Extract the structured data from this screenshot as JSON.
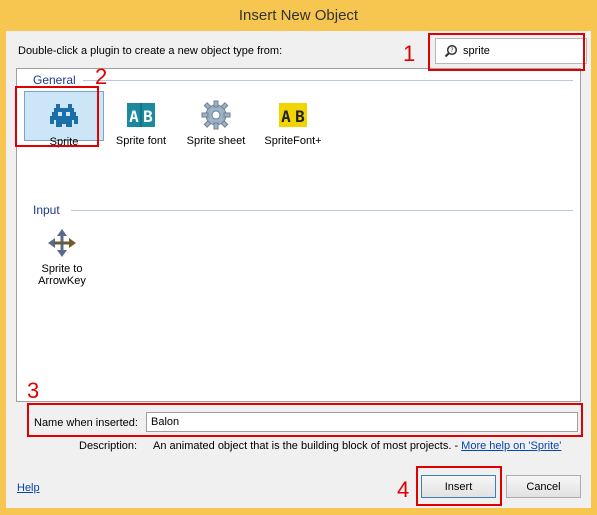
{
  "window": {
    "title": "Insert New Object"
  },
  "instruction": "Double-click a plugin to create a new object type from:",
  "search": {
    "value": "sprite"
  },
  "groups": [
    {
      "label": "General",
      "items": [
        {
          "label": "Sprite",
          "icon": "space-invader-icon",
          "selected": true
        },
        {
          "label": "Sprite font",
          "icon": "ab-font-icon"
        },
        {
          "label": "Sprite sheet",
          "icon": "gear-icon"
        },
        {
          "label": "SpriteFont+",
          "icon": "ab-font-yellow-icon"
        }
      ]
    },
    {
      "label": "Input",
      "items": [
        {
          "label": "Sprite to ArrowKey",
          "icon": "four-arrows-icon"
        }
      ]
    }
  ],
  "name_field": {
    "label": "Name when inserted:",
    "value": "Balon"
  },
  "description": {
    "label": "Description:",
    "text": "An animated object that is the building block of most projects. -",
    "link": "More help on 'Sprite'"
  },
  "footer": {
    "help": "Help",
    "insert": "Insert",
    "cancel": "Cancel"
  },
  "annotations": [
    "1",
    "2",
    "3",
    "4"
  ],
  "colors": {
    "annotation": "#e00000",
    "selection": "#cde6f7",
    "group_header": "#1e3a8a",
    "titlebar": "#f6c650"
  }
}
